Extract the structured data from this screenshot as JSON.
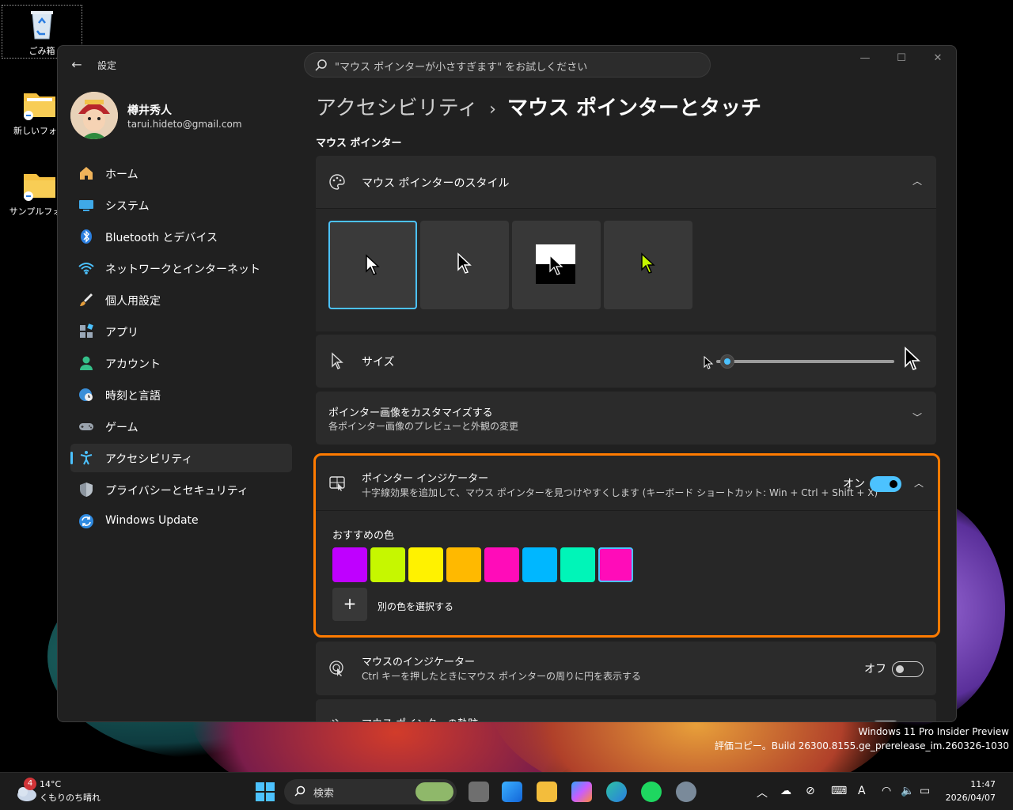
{
  "desktop": {
    "icons": [
      {
        "label": "ごみ箱"
      },
      {
        "label": "新しいフォル"
      },
      {
        "label": "サンプルフォル"
      }
    ]
  },
  "window": {
    "app_title": "設定",
    "search_placeholder": "\"マウス ポインターが小さすぎます\" をお試しください"
  },
  "user": {
    "name": "樽井秀人",
    "email": "tarui.hideto@gmail.com"
  },
  "sidebar": {
    "items": [
      {
        "label": "ホーム",
        "icon": "home-icon"
      },
      {
        "label": "システム",
        "icon": "system-icon"
      },
      {
        "label": "Bluetooth とデバイス",
        "icon": "bluetooth-icon"
      },
      {
        "label": "ネットワークとインターネット",
        "icon": "wifi-icon"
      },
      {
        "label": "個人用設定",
        "icon": "brush-icon"
      },
      {
        "label": "アプリ",
        "icon": "apps-icon"
      },
      {
        "label": "アカウント",
        "icon": "account-icon"
      },
      {
        "label": "時刻と言語",
        "icon": "globe-clock-icon"
      },
      {
        "label": "ゲーム",
        "icon": "gamepad-icon"
      },
      {
        "label": "アクセシビリティ",
        "icon": "accessibility-icon",
        "active": true
      },
      {
        "label": "プライバシーとセキュリティ",
        "icon": "shield-icon"
      },
      {
        "label": "Windows Update",
        "icon": "update-icon"
      }
    ]
  },
  "breadcrumb": {
    "parent": "アクセシビリティ",
    "separator": "›",
    "current": "マウス ポインターとタッチ"
  },
  "section_title": "マウス ポインター",
  "pointer_style": {
    "title": "マウス ポインターのスタイル",
    "options": [
      "white",
      "black",
      "inverted",
      "custom"
    ],
    "selected": "white"
  },
  "size": {
    "title": "サイズ",
    "value": 1,
    "min": 1,
    "max": 15
  },
  "customize": {
    "title": "ポインター画像をカスタマイズする",
    "subtitle": "各ポインター画像のプレビューと外観の変更"
  },
  "pointer_indicator": {
    "title": "ポインター インジケーター",
    "subtitle": "十字線効果を追加して、マウス ポインターを見つけやすくします (キーボード ショートカット: Win + Ctrl + Shift + X)",
    "state_label": "オン",
    "enabled": true,
    "colors_title": "おすすめの色",
    "colors": [
      "#bf00ff",
      "#c6f700",
      "#fff200",
      "#ffb900",
      "#ff0cb9",
      "#00b7ff",
      "#00f5b8",
      "#ff0cb9"
    ],
    "selected_color_index": 7,
    "other_color_label": "別の色を選択する",
    "highlight_color": "#ff7b00"
  },
  "mouse_indicator": {
    "title": "マウスのインジケーター",
    "subtitle": "Ctrl キーを押したときにマウス ポインターの周りに円を表示する",
    "state_label": "オフ",
    "enabled": false
  },
  "trail": {
    "title": "マウス ポインターの軌跡",
    "state_label": "オフ",
    "enabled": false
  },
  "watermark": {
    "line1": "Windows 11 Pro Insider Preview",
    "line2": "評価コピー。Build 26300.8155.ge_prerelease_im.260326-1030"
  },
  "taskbar": {
    "weather_temp": "14°C",
    "weather_desc": "くもりのち晴れ",
    "weather_badge": "4",
    "search_label": "検索",
    "time": "11:47",
    "date": "2026/04/07",
    "ime": "A"
  },
  "colors": {
    "accent": "#4cc2ff",
    "window_bg": "#202020",
    "card_bg": "#2b2b2b"
  }
}
